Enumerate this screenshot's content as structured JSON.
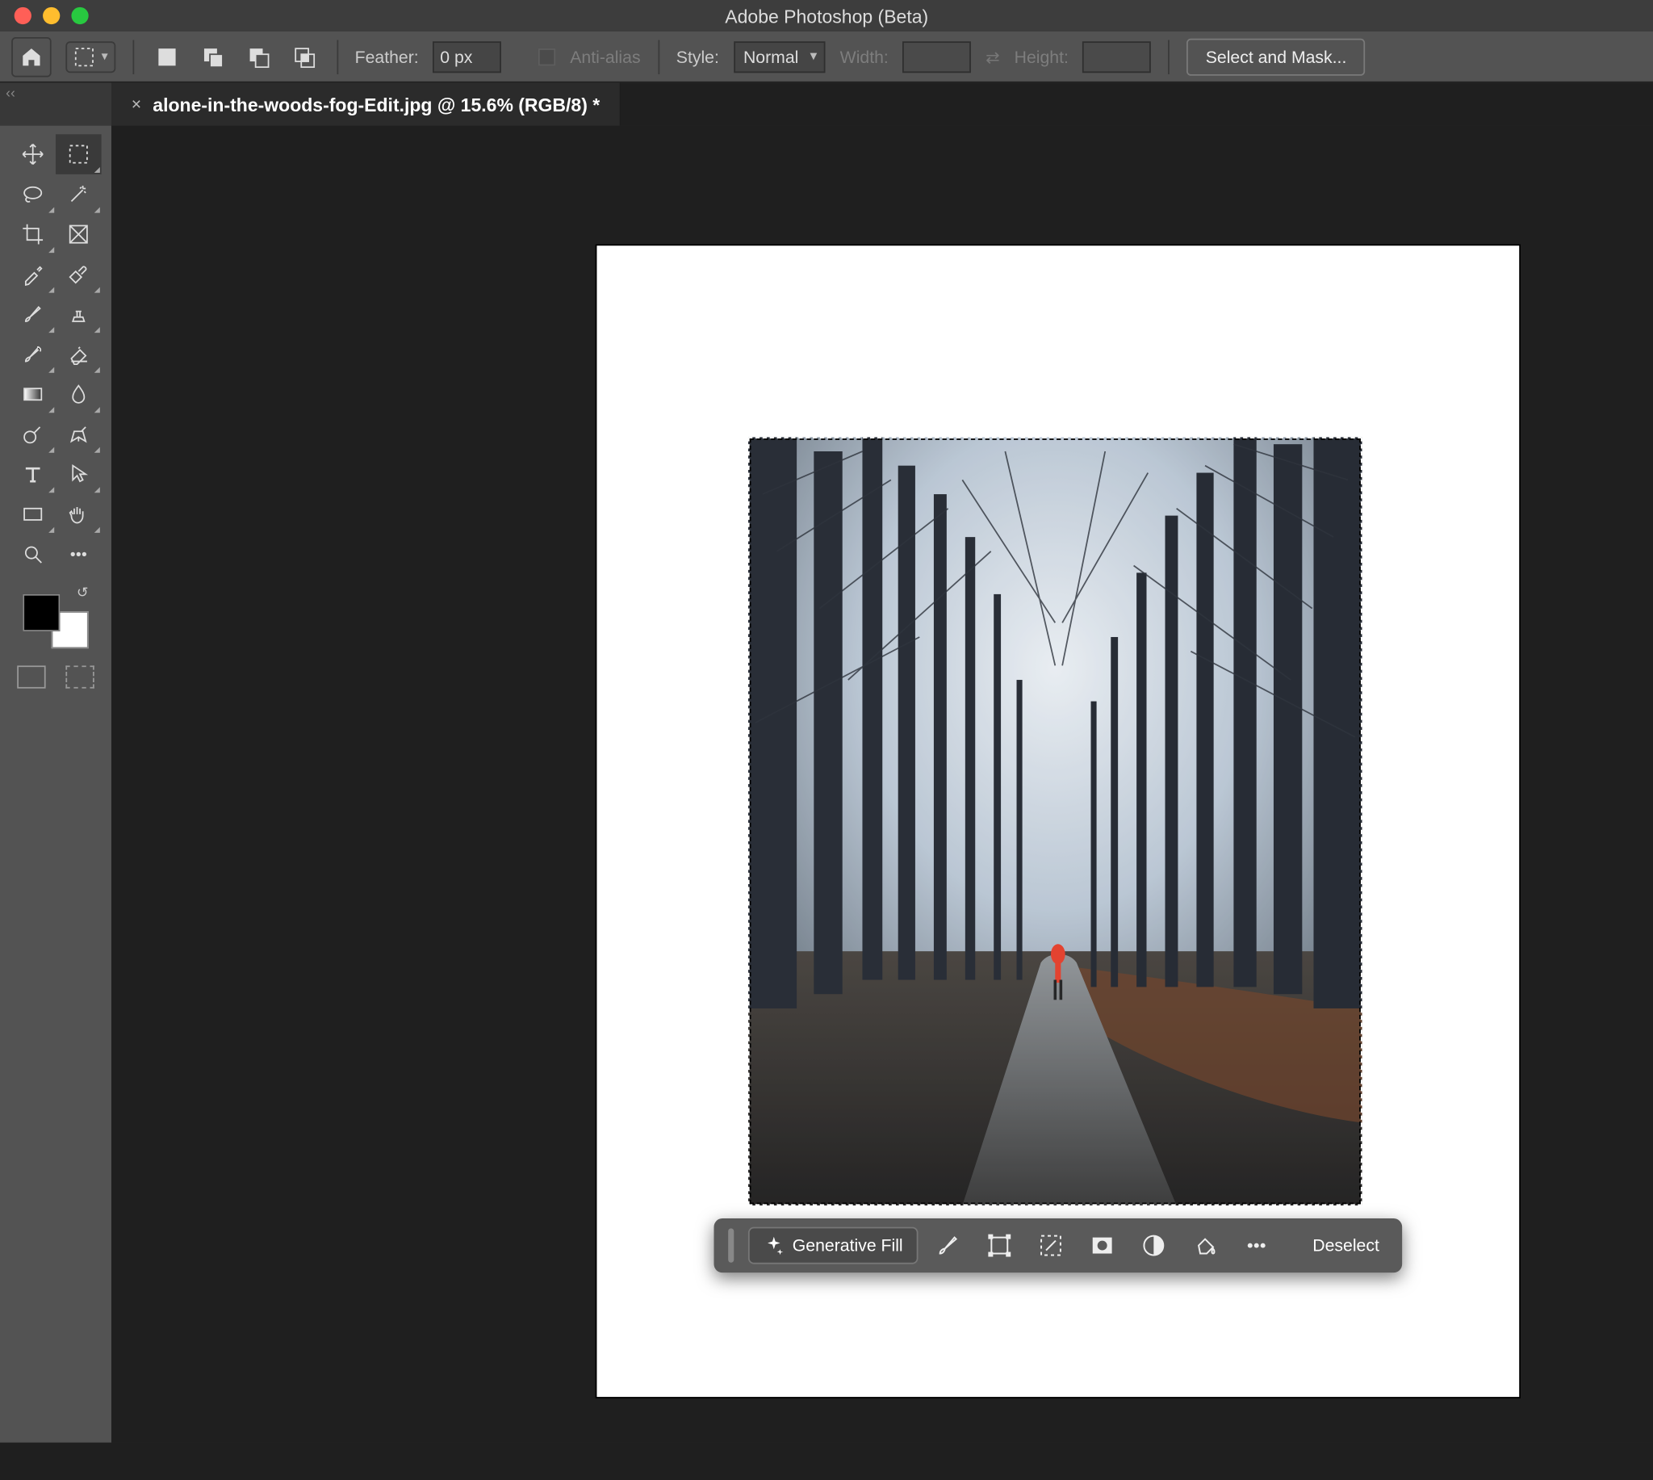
{
  "app_title": "Adobe Photoshop (Beta)",
  "tab": {
    "label": "alone-in-the-woods-fog-Edit.jpg @ 15.6% (RGB/8) *"
  },
  "options": {
    "feather_label": "Feather:",
    "feather_value": "0 px",
    "antialias_label": "Anti-alias",
    "style_label": "Style:",
    "style_value": "Normal",
    "width_label": "Width:",
    "height_label": "Height:",
    "select_and_mask": "Select and Mask..."
  },
  "toolbox_tools": [
    "move",
    "rect-marquee",
    "lasso",
    "magic-wand",
    "crop",
    "frame",
    "eyedropper",
    "healing",
    "brush",
    "clone",
    "history-brush",
    "eraser",
    "gradient",
    "blur",
    "dodge",
    "pen",
    "type",
    "path-select",
    "rectangle",
    "hand",
    "zoom",
    "more"
  ],
  "contextbar": {
    "generative_fill": "Generative Fill",
    "deselect": "Deselect",
    "icons": [
      "brush-edit",
      "transform-selection",
      "modify-selection",
      "layer-mask",
      "adjustment",
      "fill-bucket",
      "more"
    ]
  }
}
